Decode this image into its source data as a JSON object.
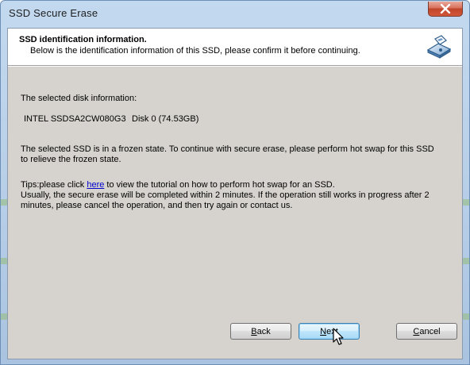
{
  "window": {
    "title": "SSD Secure Erase"
  },
  "header": {
    "title": "SSD identification information.",
    "subtitle": "Below is the identification information of this SSD, please confirm it before continuing."
  },
  "body": {
    "selected_disk_label": "The selected disk information:",
    "disk_model": "INTEL SSDSA2CW080G3",
    "disk_id": "Disk 0 (74.53GB)",
    "frozen_line1": "The selected SSD is in a frozen state. To continue with secure erase, please perform hot swap for this SSD",
    "frozen_line2": "to relieve the frozen state.",
    "tips_prefix": "Tips:please click ",
    "tips_link": "here",
    "tips_suffix": " to view the tutorial on how to perform hot swap for an SSD.",
    "usually_line1": "Usually, the secure erase will be completed within 2 minutes. If the operation still works in progress after 2",
    "usually_line2": "minutes, please cancel the operation, and then try again or contact us."
  },
  "buttons": {
    "back_mnemonic": "B",
    "back_rest": "ack",
    "next_mnemonic": "N",
    "next_rest": "ext",
    "cancel_mnemonic": "C",
    "cancel_rest": "ancel"
  },
  "icons": {
    "close": "close-icon",
    "header": "ssd-disk-icon",
    "cursor": "mouse-pointer-icon"
  },
  "colors": {
    "link": "#0000cc",
    "close_button": "#c04429",
    "default_button_border": "#3c7fb1"
  }
}
